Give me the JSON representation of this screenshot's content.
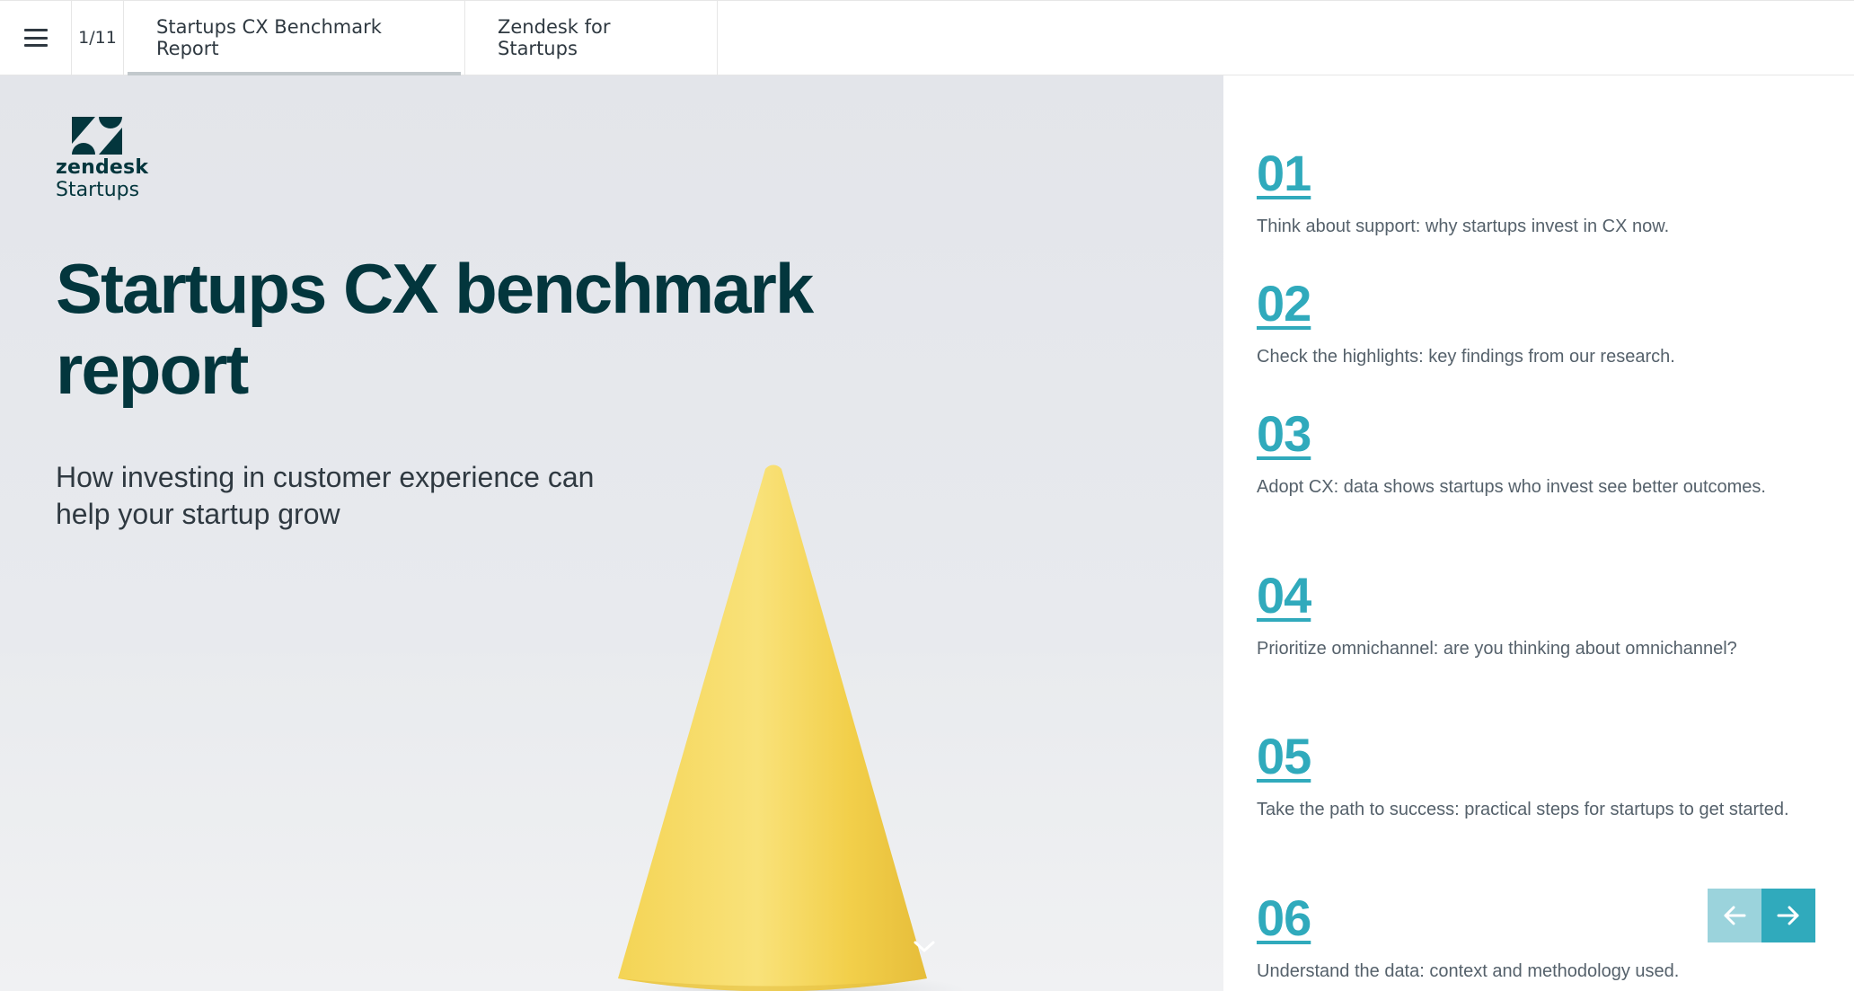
{
  "topbar": {
    "menu_icon": "hamburger-menu-icon",
    "page_indicator": "1/11",
    "tabs": [
      {
        "label": "Startups CX Benchmark Report",
        "active": true
      },
      {
        "label": "Zendesk for Startups",
        "active": false
      }
    ]
  },
  "hero": {
    "logo_word": "zendesk",
    "logo_sub": "Startups",
    "title": "Startups CX benchmark report",
    "subtitle": "How investing in customer experience can help your startup grow",
    "scroll_icon": "chevron-down-icon"
  },
  "toc": {
    "items": [
      {
        "number": "01",
        "description": "Think about support: why startups invest in CX now."
      },
      {
        "number": "02",
        "description": "Check the highlights: key findings from our research."
      },
      {
        "number": "03",
        "description": "Adopt CX: data shows startups who invest see better outcomes."
      },
      {
        "number": "04",
        "description": "Prioritize omnichannel: are you thinking about omnichannel?"
      },
      {
        "number": "05",
        "description": "Take the path to success: practical steps for startups to get started."
      },
      {
        "number": "06",
        "description": "Understand the data: context and methodology used."
      }
    ]
  },
  "controls": {
    "prev_icon": "arrow-left-icon",
    "next_icon": "arrow-right-icon"
  },
  "colors": {
    "brand_dark": "#03363d",
    "accent": "#30aabc",
    "accent_light": "#9bd3dc",
    "cone_yellow": "#f6d85a"
  }
}
